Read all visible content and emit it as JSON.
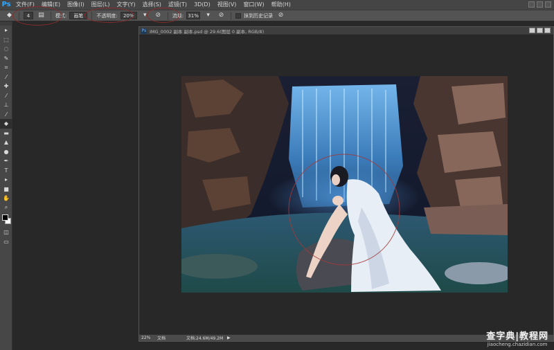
{
  "app": {
    "logo": "Ps"
  },
  "menu": [
    "文件(F)",
    "编辑(E)",
    "图像(I)",
    "图层(L)",
    "文字(Y)",
    "选择(S)",
    "滤镜(T)",
    "3D(D)",
    "视图(V)",
    "窗口(W)",
    "帮助(H)"
  ],
  "options": {
    "brush_size": "4",
    "mode_label": "模式:",
    "mode_value": "画笔",
    "opacity_label": "不透明度:",
    "opacity_value": "20%",
    "flow_label": "流量:",
    "flow_value": "31%",
    "erase_history_label": "抹到历史记录"
  },
  "tools": [
    {
      "icon": "move-icon",
      "glyph": "▸"
    },
    {
      "icon": "marquee-icon",
      "glyph": "⬚"
    },
    {
      "icon": "lasso-icon",
      "glyph": "◌"
    },
    {
      "icon": "quick-select-icon",
      "glyph": "✎"
    },
    {
      "icon": "crop-icon",
      "glyph": "⌗"
    },
    {
      "icon": "eyedropper-icon",
      "glyph": "⁄"
    },
    {
      "icon": "healing-brush-icon",
      "glyph": "✚"
    },
    {
      "icon": "brush-icon",
      "glyph": "⁄"
    },
    {
      "icon": "clone-stamp-icon",
      "glyph": "⊥"
    },
    {
      "icon": "history-brush-icon",
      "glyph": "⁄"
    },
    {
      "icon": "eraser-icon",
      "glyph": "◆",
      "active": true
    },
    {
      "icon": "gradient-icon",
      "glyph": "▬"
    },
    {
      "icon": "blur-icon",
      "glyph": "▲"
    },
    {
      "icon": "dodge-icon",
      "glyph": "●"
    },
    {
      "icon": "pen-icon",
      "glyph": "✒"
    },
    {
      "icon": "type-icon",
      "glyph": "T"
    },
    {
      "icon": "path-select-icon",
      "glyph": "▸"
    },
    {
      "icon": "shape-icon",
      "glyph": "■"
    },
    {
      "icon": "hand-icon",
      "glyph": "✋"
    },
    {
      "icon": "zoom-icon",
      "glyph": "⌕"
    }
  ],
  "document": {
    "title": "IMG_0002 副本 副本.psd @ 29.6(图层 0 副本, RGB/8)",
    "zoom": "22%",
    "doc_label": "文档",
    "doc_info": "文档:24.6M/49.2M"
  },
  "watermark": {
    "title": "查字典|教程网",
    "url": "jiaocheng.chazidian.com"
  },
  "colors": {
    "foreground": "#000000",
    "background": "#ffffff",
    "accent": "#31a8ff"
  }
}
